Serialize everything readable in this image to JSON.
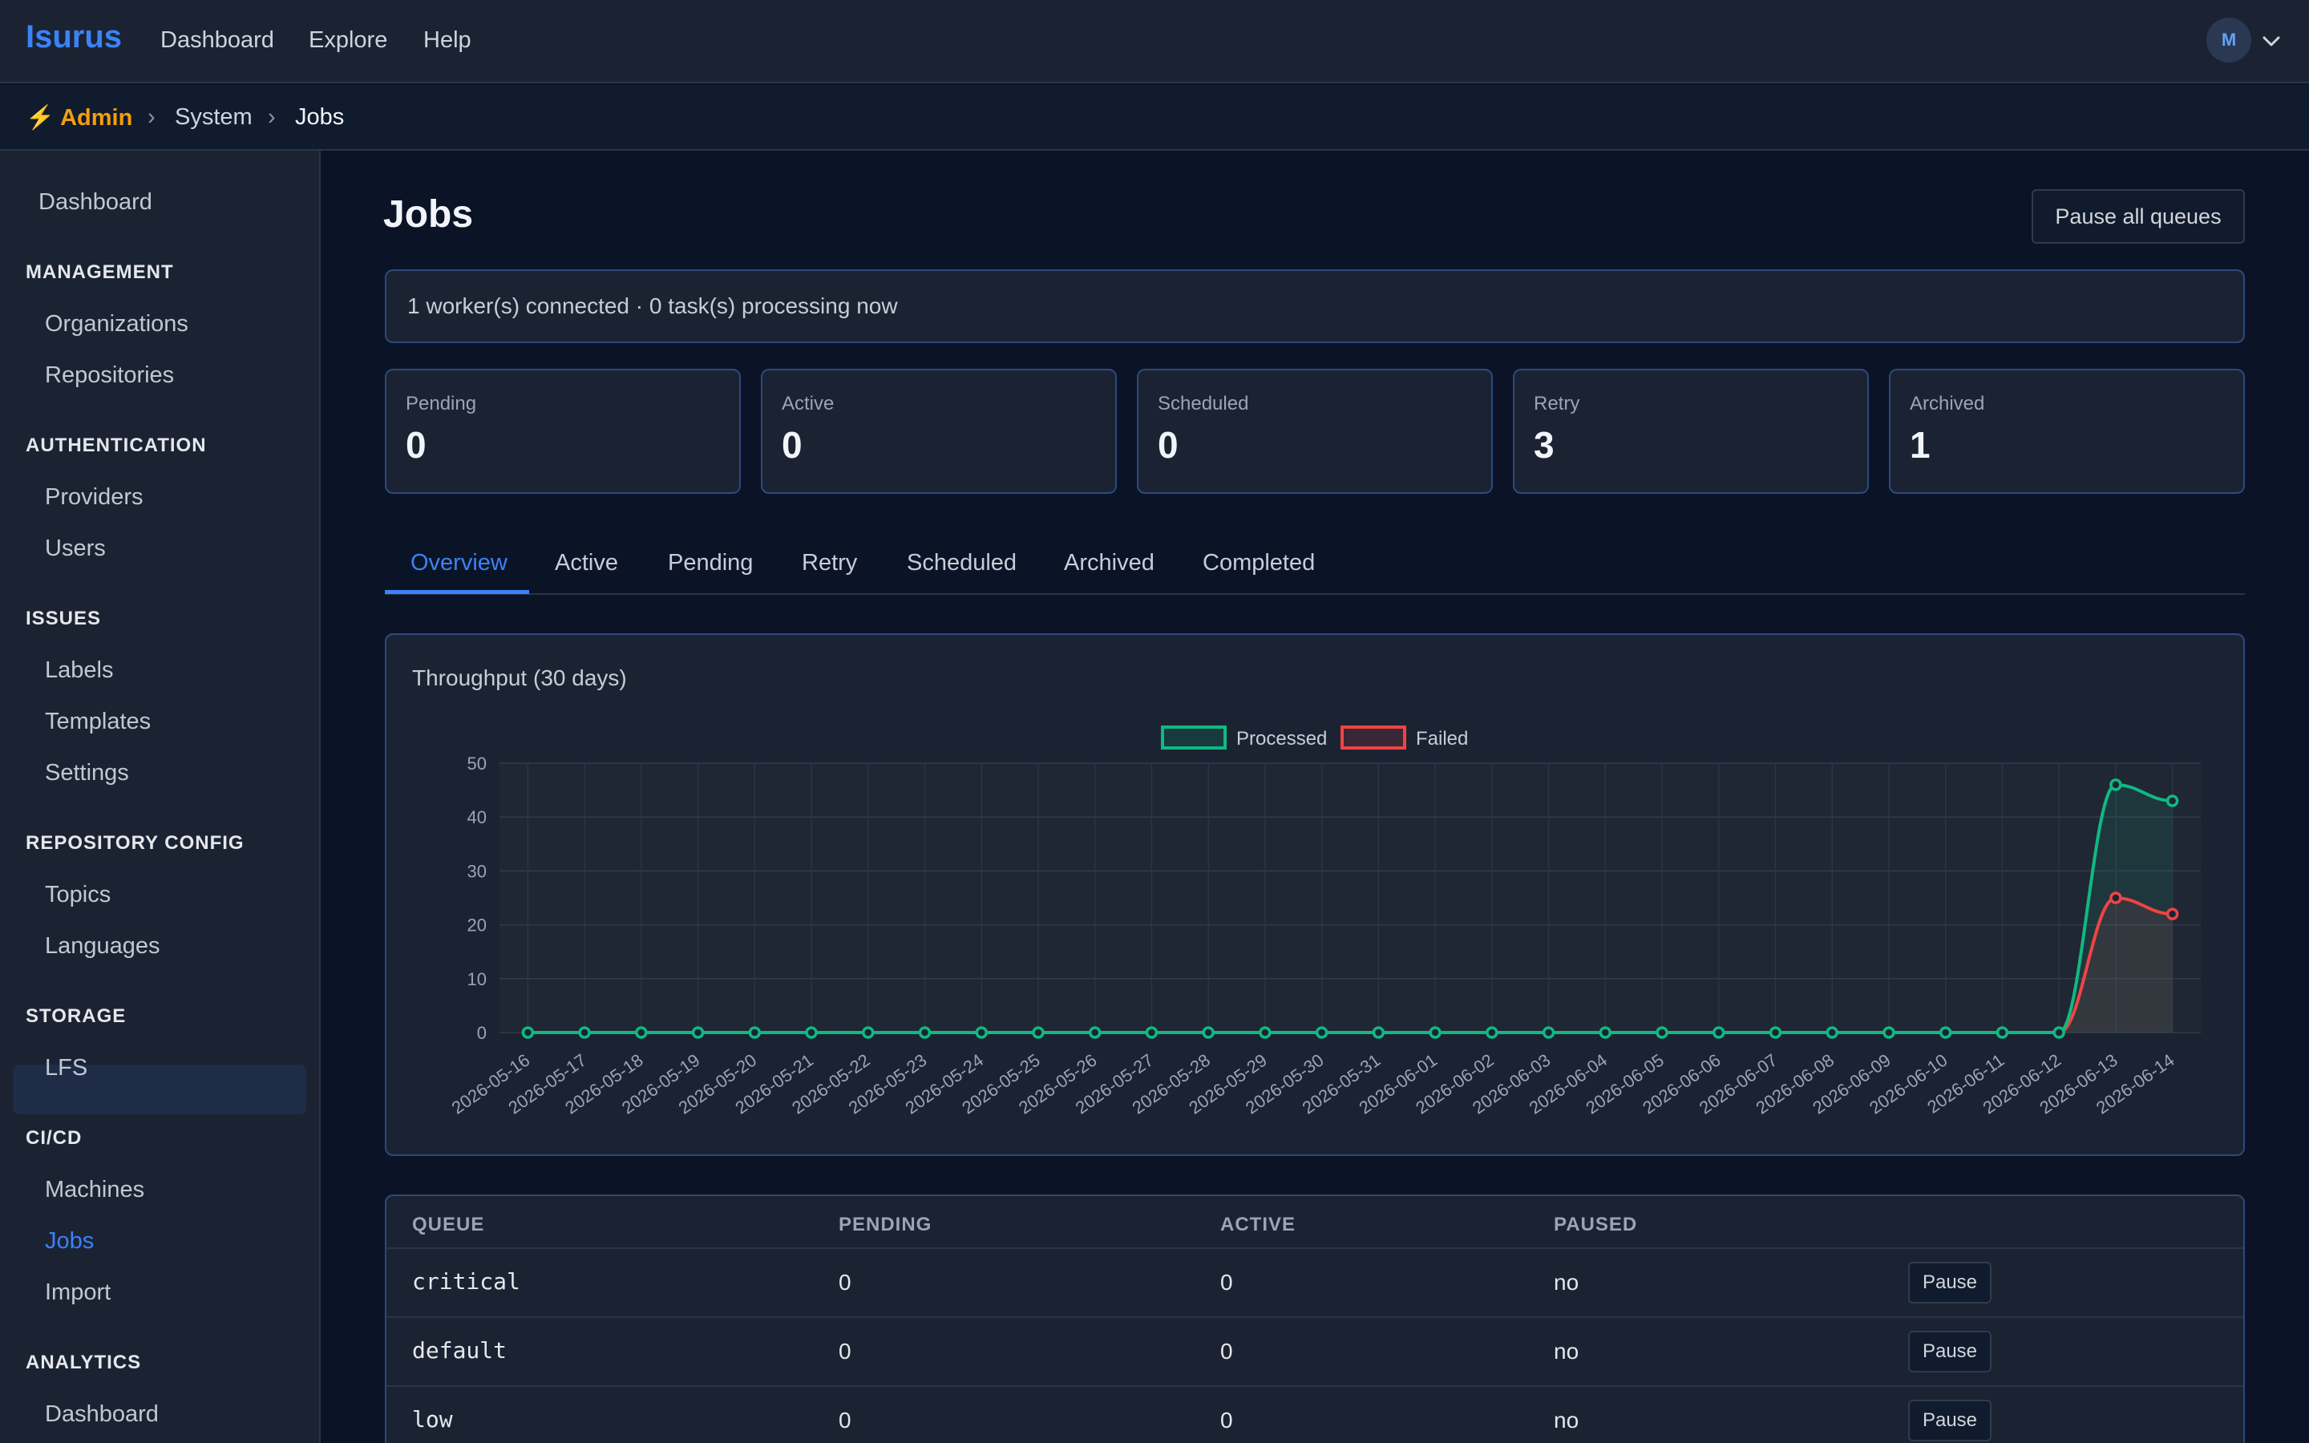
{
  "app": {
    "brand": "Isurus"
  },
  "topnav": {
    "links": [
      "Dashboard",
      "Explore",
      "Help"
    ],
    "avatar_initial": "M"
  },
  "breadcrumb": {
    "admin": "Admin",
    "section": "System",
    "current": "Jobs",
    "separator": "›"
  },
  "sidebar": {
    "top_item": "Dashboard",
    "sections": [
      {
        "title": "MANAGEMENT",
        "items": [
          "Organizations",
          "Repositories"
        ]
      },
      {
        "title": "AUTHENTICATION",
        "items": [
          "Providers",
          "Users"
        ]
      },
      {
        "title": "ISSUES",
        "items": [
          "Labels",
          "Templates",
          "Settings"
        ]
      },
      {
        "title": "REPOSITORY CONFIG",
        "items": [
          "Topics",
          "Languages"
        ]
      },
      {
        "title": "STORAGE",
        "items": [
          "LFS"
        ]
      },
      {
        "title": "CI/CD",
        "items": [
          "Machines",
          "Jobs",
          "Import"
        ]
      },
      {
        "title": "ANALYTICS",
        "items": [
          "Dashboard"
        ]
      }
    ],
    "active_item": "Jobs"
  },
  "page": {
    "title": "Jobs",
    "pause_all_label": "Pause all queues",
    "status_text": "1 worker(s) connected · 0 task(s) processing now"
  },
  "stats": [
    {
      "label": "Pending",
      "value": "0"
    },
    {
      "label": "Active",
      "value": "0"
    },
    {
      "label": "Scheduled",
      "value": "0"
    },
    {
      "label": "Retry",
      "value": "3"
    },
    {
      "label": "Archived",
      "value": "1"
    }
  ],
  "tabs": [
    "Overview",
    "Active",
    "Pending",
    "Retry",
    "Scheduled",
    "Archived",
    "Completed"
  ],
  "active_tab": "Overview",
  "chart_data": {
    "type": "line",
    "title": "Throughput (30 days)",
    "x": [
      "2026-05-16",
      "2026-05-17",
      "2026-05-18",
      "2026-05-19",
      "2026-05-20",
      "2026-05-21",
      "2026-05-22",
      "2026-05-23",
      "2026-05-24",
      "2026-05-25",
      "2026-05-26",
      "2026-05-27",
      "2026-05-28",
      "2026-05-29",
      "2026-05-30",
      "2026-05-31",
      "2026-06-01",
      "2026-06-02",
      "2026-06-03",
      "2026-06-04",
      "2026-06-05",
      "2026-06-06",
      "2026-06-07",
      "2026-06-08",
      "2026-06-09",
      "2026-06-10",
      "2026-06-11",
      "2026-06-12",
      "2026-06-13",
      "2026-06-14"
    ],
    "series": [
      {
        "name": "Processed",
        "color": "#10b981",
        "values": [
          0,
          0,
          0,
          0,
          0,
          0,
          0,
          0,
          0,
          0,
          0,
          0,
          0,
          0,
          0,
          0,
          0,
          0,
          0,
          0,
          0,
          0,
          0,
          0,
          0,
          0,
          0,
          0,
          46,
          43
        ]
      },
      {
        "name": "Failed",
        "color": "#ef4444",
        "values": [
          0,
          0,
          0,
          0,
          0,
          0,
          0,
          0,
          0,
          0,
          0,
          0,
          0,
          0,
          0,
          0,
          0,
          0,
          0,
          0,
          0,
          0,
          0,
          0,
          0,
          0,
          0,
          0,
          25,
          22
        ]
      }
    ],
    "ylim": [
      0,
      50
    ],
    "yticks": [
      0,
      10,
      20,
      30,
      40,
      50
    ],
    "grid": true,
    "legend": "top-center"
  },
  "queue_table": {
    "headers": [
      "QUEUE",
      "PENDING",
      "ACTIVE",
      "PAUSED"
    ],
    "action_label": "Pause",
    "rows": [
      {
        "queue": "critical",
        "pending": "0",
        "active": "0",
        "paused": "no"
      },
      {
        "queue": "default",
        "pending": "0",
        "active": "0",
        "paused": "no"
      },
      {
        "queue": "low",
        "pending": "0",
        "active": "0",
        "paused": "no"
      }
    ]
  }
}
